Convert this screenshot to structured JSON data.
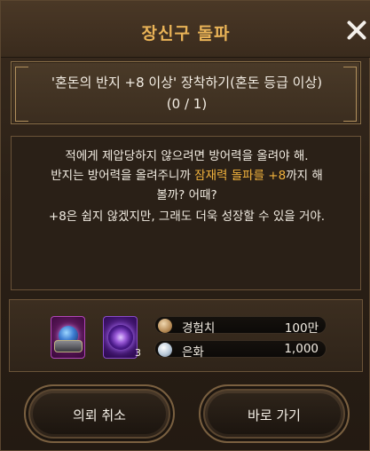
{
  "window": {
    "title": "장신구 돌파"
  },
  "quest": {
    "line1": "'혼돈의 반지 +8 이상' 장착하기(혼돈 등급 이상)",
    "progress": "(0 / 1)"
  },
  "description": {
    "line1": "적에게 제압당하지 않으려면 방어력을 올려야 해.",
    "line2_pre": "반지는 방어력을 올려주니까 ",
    "line2_highlight": "잠재력 돌파를 +8",
    "line2_post": "까지 해",
    "line3": "볼까? 어때?",
    "line4": "+8은 쉽지 않겠지만, 그래도 더욱 성장할 수 있을 거야."
  },
  "rewards": {
    "items": [
      {
        "icon": "chaos-ring-icon",
        "count": ""
      },
      {
        "icon": "purple-orb-icon",
        "count": "3"
      }
    ],
    "exp": {
      "icon": "exp-coin-icon",
      "label": "경험치",
      "value": "100만"
    },
    "silver": {
      "icon": "silver-coin-icon",
      "label": "은화",
      "value": "1,000"
    }
  },
  "buttons": {
    "cancel": "의뢰 취소",
    "go": "바로 가기"
  },
  "colors": {
    "title": "#e9b357",
    "highlight": "#f2b33d"
  }
}
